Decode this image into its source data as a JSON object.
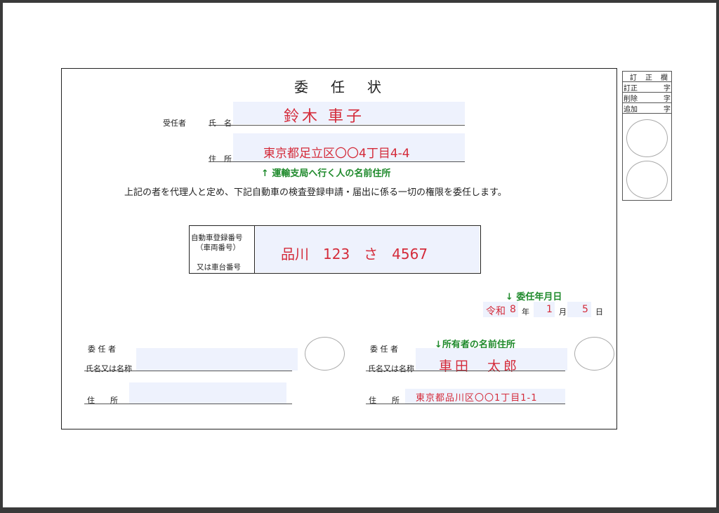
{
  "document": {
    "title": "委　任　状",
    "trustee_label": "受任者",
    "name_label": "氏　名",
    "address_label": "住　所",
    "trustee_name": "鈴木 車子",
    "trustee_address": "東京都足立区〇〇4丁目4-4",
    "trustee_note": "↑ 運輸支局へ行く人の名前住所",
    "statement": "上記の者を代理人と定め、下記自動車の検査登録申請・届出に係る一切の権限を委任します。",
    "vehicle_label_line1": "自動車登録番号",
    "vehicle_label_line2": "（車両番号）",
    "vehicle_label_line3": "又は車台番号",
    "vehicle_number": "品川　123　さ　4567",
    "date_note": "↓ 委任年月日",
    "era": "令和",
    "year": "8",
    "year_unit": "年",
    "month": "1",
    "month_unit": "月",
    "day": "5",
    "day_unit": "日",
    "delegator_left_label": "委 任 者",
    "delegator_left_name_label": "氏名又は名称",
    "delegator_left_address_label": "住　　所",
    "delegator_right_label": "委 任 者",
    "owner_note": "↓所有者の名前住所",
    "delegator_right_name_label": "氏名又は名称",
    "delegator_right_name": "車田　太郎",
    "delegator_right_address_label": "住　　所",
    "delegator_right_address": "東京都品川区〇〇1丁目1-1"
  },
  "correction_box": {
    "header": "訂　正　欄",
    "rows": [
      {
        "label": "訂正",
        "unit": "字"
      },
      {
        "label": "削除",
        "unit": "字"
      },
      {
        "label": "追加",
        "unit": "字"
      }
    ]
  }
}
